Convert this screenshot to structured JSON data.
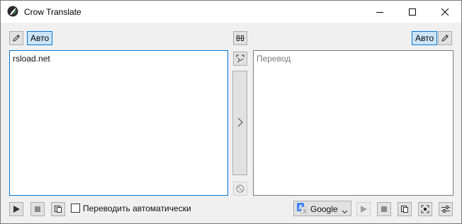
{
  "window": {
    "title": "Crow Translate"
  },
  "source": {
    "language_button": "Авто",
    "text": "rsload.net"
  },
  "translation": {
    "language_button": "Авто",
    "placeholder": "Перевод"
  },
  "bottom": {
    "auto_translate_label": "Переводить автоматически",
    "auto_translate_checked": false,
    "engine": "Google"
  },
  "icons": {
    "app": "crow-icon",
    "minimize": "minimize-icon",
    "maximize": "maximize-icon",
    "close": "close-icon",
    "edit": "pencil-icon",
    "swap_languages": "swap-languages-icon",
    "ocr_selection": "screen-selection-icon",
    "translate": "chevron-right-icon",
    "abort": "abort-icon",
    "play": "play-icon",
    "stop": "stop-icon",
    "copy": "copy-icon",
    "ocr": "ocr-icon",
    "settings": "settings-icon",
    "engine": "google-translate-icon",
    "dropdown": "chevron-down-icon"
  },
  "colors": {
    "accent": "#0078d7",
    "selected_bg": "#cce4f7",
    "window_bg": "#f0f0f0"
  }
}
